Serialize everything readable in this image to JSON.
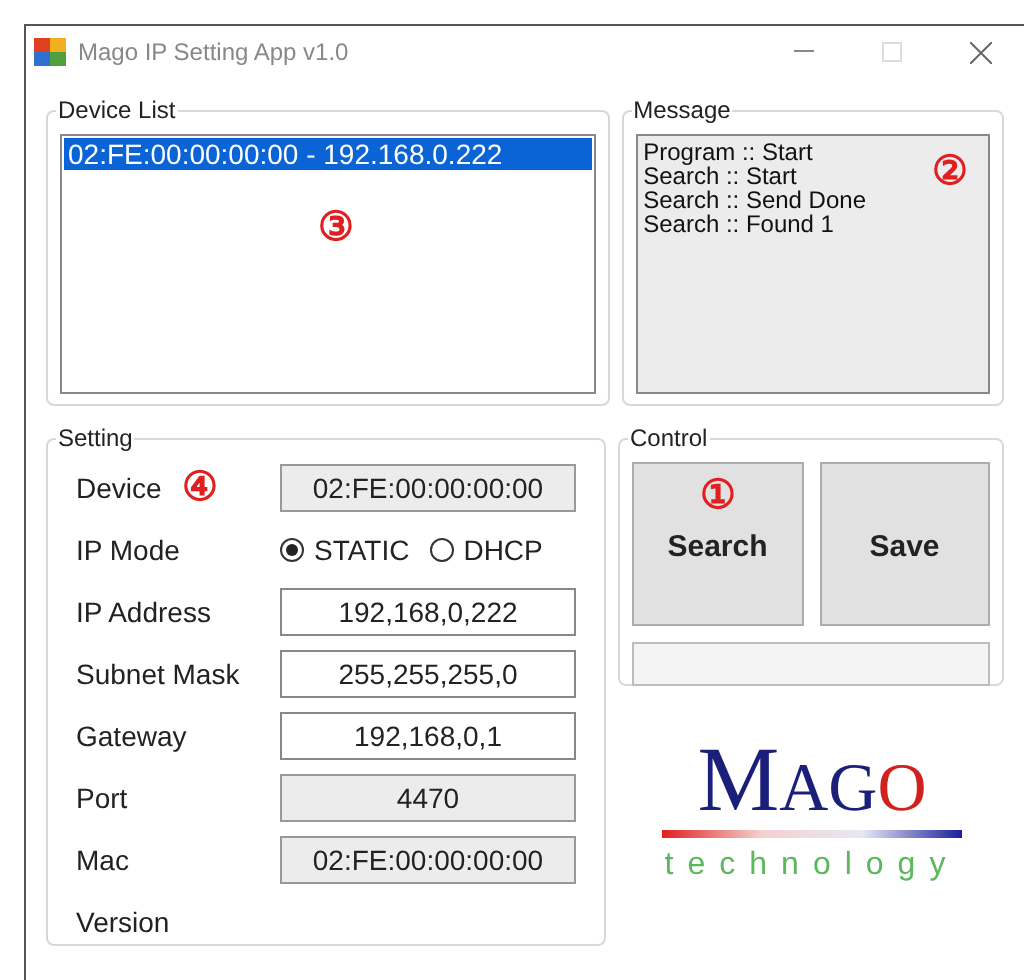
{
  "window": {
    "title": "Mago IP Setting App v1.0"
  },
  "device_list": {
    "title": "Device List",
    "items": [
      {
        "text": "02:FE:00:00:00:00 - 192.168.0.222",
        "selected": true
      }
    ],
    "marker": "③"
  },
  "message": {
    "title": "Message",
    "lines": [
      "Program :: Start",
      "Search :: Start",
      "Search :: Send Done",
      "Search :: Found 1"
    ],
    "marker": "②"
  },
  "setting": {
    "title": "Setting",
    "rows": [
      {
        "kind": "field",
        "label": "Device",
        "value": "02:FE:00:00:00:00",
        "readonly": true,
        "marker": "④"
      },
      {
        "kind": "radio",
        "label": "IP Mode",
        "options": [
          {
            "label": "STATIC",
            "selected": true
          },
          {
            "label": "DHCP",
            "selected": false
          }
        ]
      },
      {
        "kind": "field",
        "label": "IP Address",
        "value": "192,168,0,222",
        "readonly": false
      },
      {
        "kind": "field",
        "label": "Subnet Mask",
        "value": "255,255,255,0",
        "readonly": false
      },
      {
        "kind": "field",
        "label": "Gateway",
        "value": "192,168,0,1",
        "readonly": false
      },
      {
        "kind": "field",
        "label": "Port",
        "value": "4470",
        "readonly": true
      },
      {
        "kind": "field",
        "label": "Mac",
        "value": "02:FE:00:00:00:00",
        "readonly": true
      },
      {
        "kind": "label",
        "label": "Version"
      }
    ]
  },
  "control": {
    "title": "Control",
    "buttons": [
      {
        "label": "Search",
        "marker": "①"
      },
      {
        "label": "Save"
      }
    ],
    "progress": {
      "level": 0
    }
  },
  "logo": {
    "parts": [
      {
        "text": "M",
        "kind": "initial"
      },
      {
        "text": "AG",
        "kind": "small"
      },
      {
        "text": "O",
        "kind": "accent"
      }
    ],
    "tagline": "technology"
  }
}
